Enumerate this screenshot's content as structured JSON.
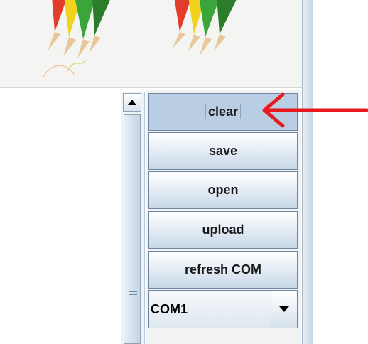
{
  "buttons": {
    "clear": "clear",
    "save": "save",
    "open": "open",
    "upload": "upload",
    "refresh_com": "refresh COM"
  },
  "port_select": {
    "selected": "COM1"
  },
  "annotation": {
    "arrow_color": "#e8191c",
    "points_to": "clear-button"
  }
}
